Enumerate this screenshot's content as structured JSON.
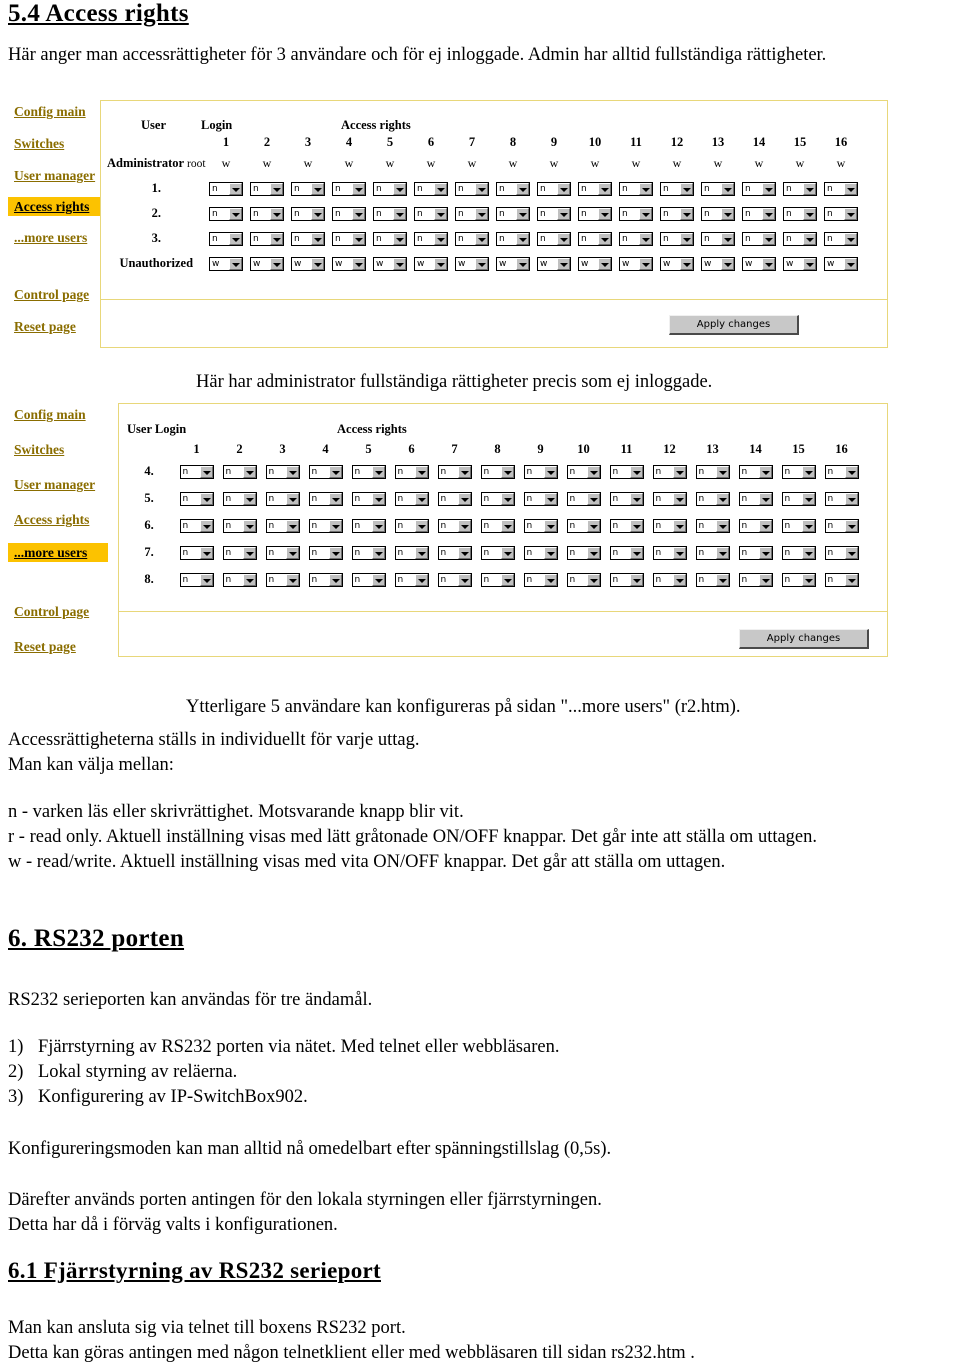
{
  "doc": {
    "heading_54": "5.4 Access rights",
    "intro": "Här anger man accessrättigheter för 3 användare och för ej inloggade. Admin har alltid fullständiga rättigheter.",
    "caption1": "Här har administrator fullständiga rättigheter precis som ej inloggade.",
    "caption2": "Ytterligare 5 användare kan konfigureras på sidan \"...more users\" (r2.htm).",
    "para_individ_1": "Accessrättigheterna ställs in individuellt för varje uttag.",
    "para_individ_2": "Man kan välja mellan:",
    "legend_n": "n - varken läs eller skrivrättighet. Motsvarande knapp blir vit.",
    "legend_r": "r - read only. Aktuell inställning visas med lätt gråtonade ON/OFF knappar. Det går inte att ställa om uttagen.",
    "legend_w": "w - read/write. Aktuell inställning visas med vita ON/OFF knappar. Det går att ställa om uttagen.",
    "heading_6": "6. RS232 porten",
    "rs232_intro": "RS232 serieporten kan användas för tre ändamål.",
    "rs232_uses": [
      {
        "num": "1)",
        "text": "Fjärrstyrning  av RS232 porten via nätet. Med telnet eller webbläsaren."
      },
      {
        "num": "2)",
        "text": "Lokal styrning av reläerna."
      },
      {
        "num": "3)",
        "text": "Konfigurering av IP-SwitchBox902."
      }
    ],
    "konfig_mode": "Konfigureringsmoden kan man alltid nå omedelbart efter spänningstillslag (0,5s).",
    "darefter_1": "Därefter används porten antingen för den lokala styrningen eller fjärrstyrningen.",
    "darefter_2": "Detta har då i förväg valts i konfigurationen.",
    "heading_61": "6.1 Fjärrstyrning av RS232 serieport",
    "telnet_1": "Man kan ansluta sig via telnet till boxens RS232 port.",
    "telnet_2": "Detta kan göras antingen med någon telnetklient eller med webbläsaren till sidan rs232.htm ."
  },
  "colors": {
    "link": "#8a6d00",
    "highlight": "#fcc200",
    "frame_border": "#e8d77a",
    "button_face": "#c8c8c8"
  },
  "screenshot1": {
    "nav": [
      {
        "label": "Config main",
        "selected": false
      },
      {
        "label": "Switches",
        "selected": false
      },
      {
        "label": "User manager",
        "selected": false
      },
      {
        "label": "Access rights",
        "selected": true
      },
      {
        "label": "...more users",
        "selected": false
      },
      {
        "label": "Control page",
        "selected": false
      },
      {
        "label": "Reset page",
        "selected": false
      }
    ],
    "headers": {
      "user": "User",
      "login": "Login",
      "access_rights": "Access rights"
    },
    "columns": [
      "1",
      "2",
      "3",
      "4",
      "5",
      "6",
      "7",
      "8",
      "9",
      "10",
      "11",
      "12",
      "13",
      "14",
      "15",
      "16"
    ],
    "rows": [
      {
        "label": "Administrator",
        "login": "root",
        "type": "text",
        "values": [
          "w",
          "w",
          "w",
          "w",
          "w",
          "w",
          "w",
          "w",
          "w",
          "w",
          "w",
          "w",
          "w",
          "w",
          "w",
          "w"
        ]
      },
      {
        "label": "1.",
        "login": "",
        "type": "select",
        "values": [
          "n",
          "n",
          "n",
          "n",
          "n",
          "n",
          "n",
          "n",
          "n",
          "n",
          "n",
          "n",
          "n",
          "n",
          "n",
          "n"
        ]
      },
      {
        "label": "2.",
        "login": "",
        "type": "select",
        "values": [
          "n",
          "n",
          "n",
          "n",
          "n",
          "n",
          "n",
          "n",
          "n",
          "n",
          "n",
          "n",
          "n",
          "n",
          "n",
          "n"
        ]
      },
      {
        "label": "3.",
        "login": "",
        "type": "select",
        "values": [
          "n",
          "n",
          "n",
          "n",
          "n",
          "n",
          "n",
          "n",
          "n",
          "n",
          "n",
          "n",
          "n",
          "n",
          "n",
          "n"
        ]
      },
      {
        "label": "Unauthorized",
        "login": "",
        "type": "select",
        "values": [
          "w",
          "w",
          "w",
          "w",
          "w",
          "w",
          "w",
          "w",
          "w",
          "w",
          "w",
          "w",
          "w",
          "w",
          "w",
          "w"
        ]
      }
    ],
    "apply_label": "Apply changes"
  },
  "screenshot2": {
    "nav": [
      {
        "label": "Config main",
        "selected": false
      },
      {
        "label": "Switches",
        "selected": false
      },
      {
        "label": "User manager",
        "selected": false
      },
      {
        "label": "Access rights",
        "selected": false
      },
      {
        "label": "...more users",
        "selected": true
      },
      {
        "label": "Control page",
        "selected": false
      },
      {
        "label": "Reset page",
        "selected": false
      }
    ],
    "headers": {
      "user_login": "User Login",
      "access_rights": "Access rights"
    },
    "columns": [
      "1",
      "2",
      "3",
      "4",
      "5",
      "6",
      "7",
      "8",
      "9",
      "10",
      "11",
      "12",
      "13",
      "14",
      "15",
      "16"
    ],
    "rows": [
      {
        "label": "4.",
        "type": "select",
        "values": [
          "n",
          "n",
          "n",
          "n",
          "n",
          "n",
          "n",
          "n",
          "n",
          "n",
          "n",
          "n",
          "n",
          "n",
          "n",
          "n"
        ]
      },
      {
        "label": "5.",
        "type": "select",
        "values": [
          "n",
          "n",
          "n",
          "n",
          "n",
          "n",
          "n",
          "n",
          "n",
          "n",
          "n",
          "n",
          "n",
          "n",
          "n",
          "n"
        ]
      },
      {
        "label": "6.",
        "type": "select",
        "values": [
          "n",
          "n",
          "n",
          "n",
          "n",
          "n",
          "n",
          "n",
          "n",
          "n",
          "n",
          "n",
          "n",
          "n",
          "n",
          "n"
        ]
      },
      {
        "label": "7.",
        "type": "select",
        "values": [
          "n",
          "n",
          "n",
          "n",
          "n",
          "n",
          "n",
          "n",
          "n",
          "n",
          "n",
          "n",
          "n",
          "n",
          "n",
          "n"
        ]
      },
      {
        "label": "8.",
        "type": "select",
        "values": [
          "n",
          "n",
          "n",
          "n",
          "n",
          "n",
          "n",
          "n",
          "n",
          "n",
          "n",
          "n",
          "n",
          "n",
          "n",
          "n"
        ]
      }
    ],
    "apply_label": "Apply changes"
  }
}
